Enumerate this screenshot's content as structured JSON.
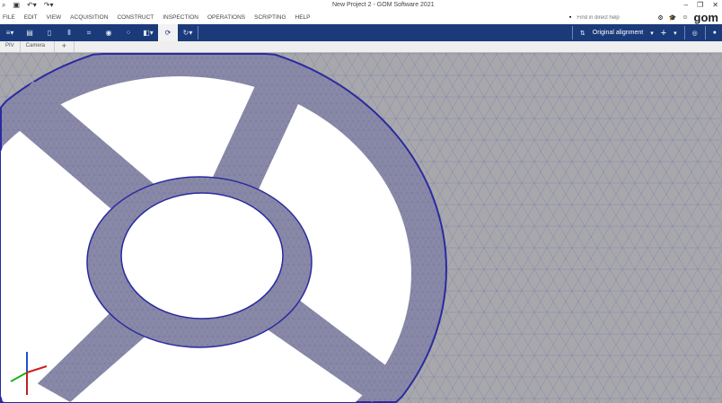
{
  "title": "New Project 2 - GOM Software 2021",
  "quick_access": [
    "search-icon",
    "save-icon",
    "undo-icon",
    "redo-icon"
  ],
  "menu": [
    "FILE",
    "EDIT",
    "VIEW",
    "ACQUISITION",
    "CONSTRUCT",
    "INSPECTION",
    "OPERATIONS",
    "SCRIPTING",
    "HELP"
  ],
  "help_placeholder": "Find in direct help",
  "logo": "gom",
  "toolbar": {
    "alignment": "Original alignment"
  },
  "tabs": [
    "PIV",
    "Camera",
    "+"
  ],
  "colors": {
    "toolbar": "#1a3a7a",
    "part": "#8a8aa6",
    "mesh_bg": "#a8a8ac"
  }
}
